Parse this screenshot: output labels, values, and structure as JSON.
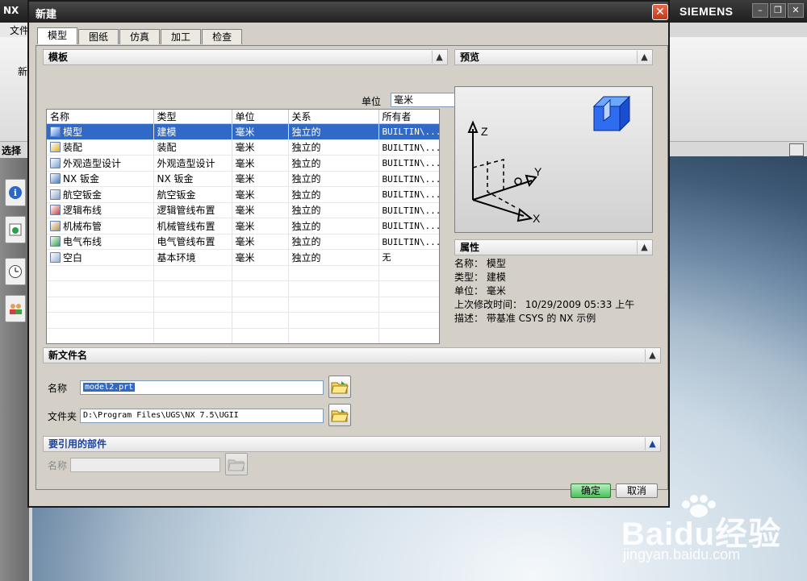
{
  "background_app": {
    "logo": "NX",
    "brand": "SIEMENS",
    "menu_file": "文件",
    "new_label": "新",
    "side_label": "选择",
    "window_controls": [
      "minimize-icon",
      "restore-icon",
      "close-icon"
    ]
  },
  "watermark": {
    "brand": "Baidu经验",
    "url": "jingyan.baidu.com"
  },
  "dialog": {
    "title": "新建",
    "tabs": [
      {
        "label": "模型",
        "active": true
      },
      {
        "label": "图纸",
        "active": false
      },
      {
        "label": "仿真",
        "active": false
      },
      {
        "label": "加工",
        "active": false
      },
      {
        "label": "检查",
        "active": false
      }
    ],
    "templates": {
      "header": "模板",
      "unit_label": "单位",
      "unit_value": "毫米",
      "columns": [
        "名称",
        "类型",
        "单位",
        "关系",
        "所有者"
      ],
      "rows": [
        {
          "name": "模型",
          "type": "建模",
          "unit": "毫米",
          "relation": "独立的",
          "owner": "BUILTIN\\...",
          "selected": true
        },
        {
          "name": "装配",
          "type": "装配",
          "unit": "毫米",
          "relation": "独立的",
          "owner": "BUILTIN\\...",
          "selected": false
        },
        {
          "name": "外观造型设计",
          "type": "外观造型设计",
          "unit": "毫米",
          "relation": "独立的",
          "owner": "BUILTIN\\...",
          "selected": false
        },
        {
          "name": "NX 钣金",
          "type": "NX 钣金",
          "unit": "毫米",
          "relation": "独立的",
          "owner": "BUILTIN\\...",
          "selected": false
        },
        {
          "name": "航空钣金",
          "type": "航空钣金",
          "unit": "毫米",
          "relation": "独立的",
          "owner": "BUILTIN\\...",
          "selected": false
        },
        {
          "name": "逻辑布线",
          "type": "逻辑管线布置",
          "unit": "毫米",
          "relation": "独立的",
          "owner": "BUILTIN\\...",
          "selected": false
        },
        {
          "name": "机械布管",
          "type": "机械管线布置",
          "unit": "毫米",
          "relation": "独立的",
          "owner": "BUILTIN\\...",
          "selected": false
        },
        {
          "name": "电气布线",
          "type": "电气管线布置",
          "unit": "毫米",
          "relation": "独立的",
          "owner": "BUILTIN\\...",
          "selected": false
        },
        {
          "name": "空白",
          "type": "基本环境",
          "unit": "毫米",
          "relation": "独立的",
          "owner": "无",
          "selected": false
        }
      ]
    },
    "preview": {
      "header": "预览",
      "axis_z": "Z",
      "axis_y": "Y",
      "axis_x": "X"
    },
    "properties": {
      "header": "属性",
      "lines": [
        "名称： 模型",
        "类型： 建模",
        "单位： 毫米",
        "上次修改时间： 10/29/2009 05:33 上午",
        "描述： 带基准 CSYS 的 NX 示例"
      ]
    },
    "new_file": {
      "header": "新文件名",
      "name_label": "名称",
      "name_value": "model2.prt",
      "folder_label": "文件夹",
      "folder_value": "D:\\Program Files\\UGS\\NX 7.5\\UGII"
    },
    "referenced": {
      "header": "要引用的部件",
      "name_label": "名称",
      "name_value": ""
    },
    "buttons": {
      "ok": "确定",
      "cancel": "取消"
    }
  }
}
